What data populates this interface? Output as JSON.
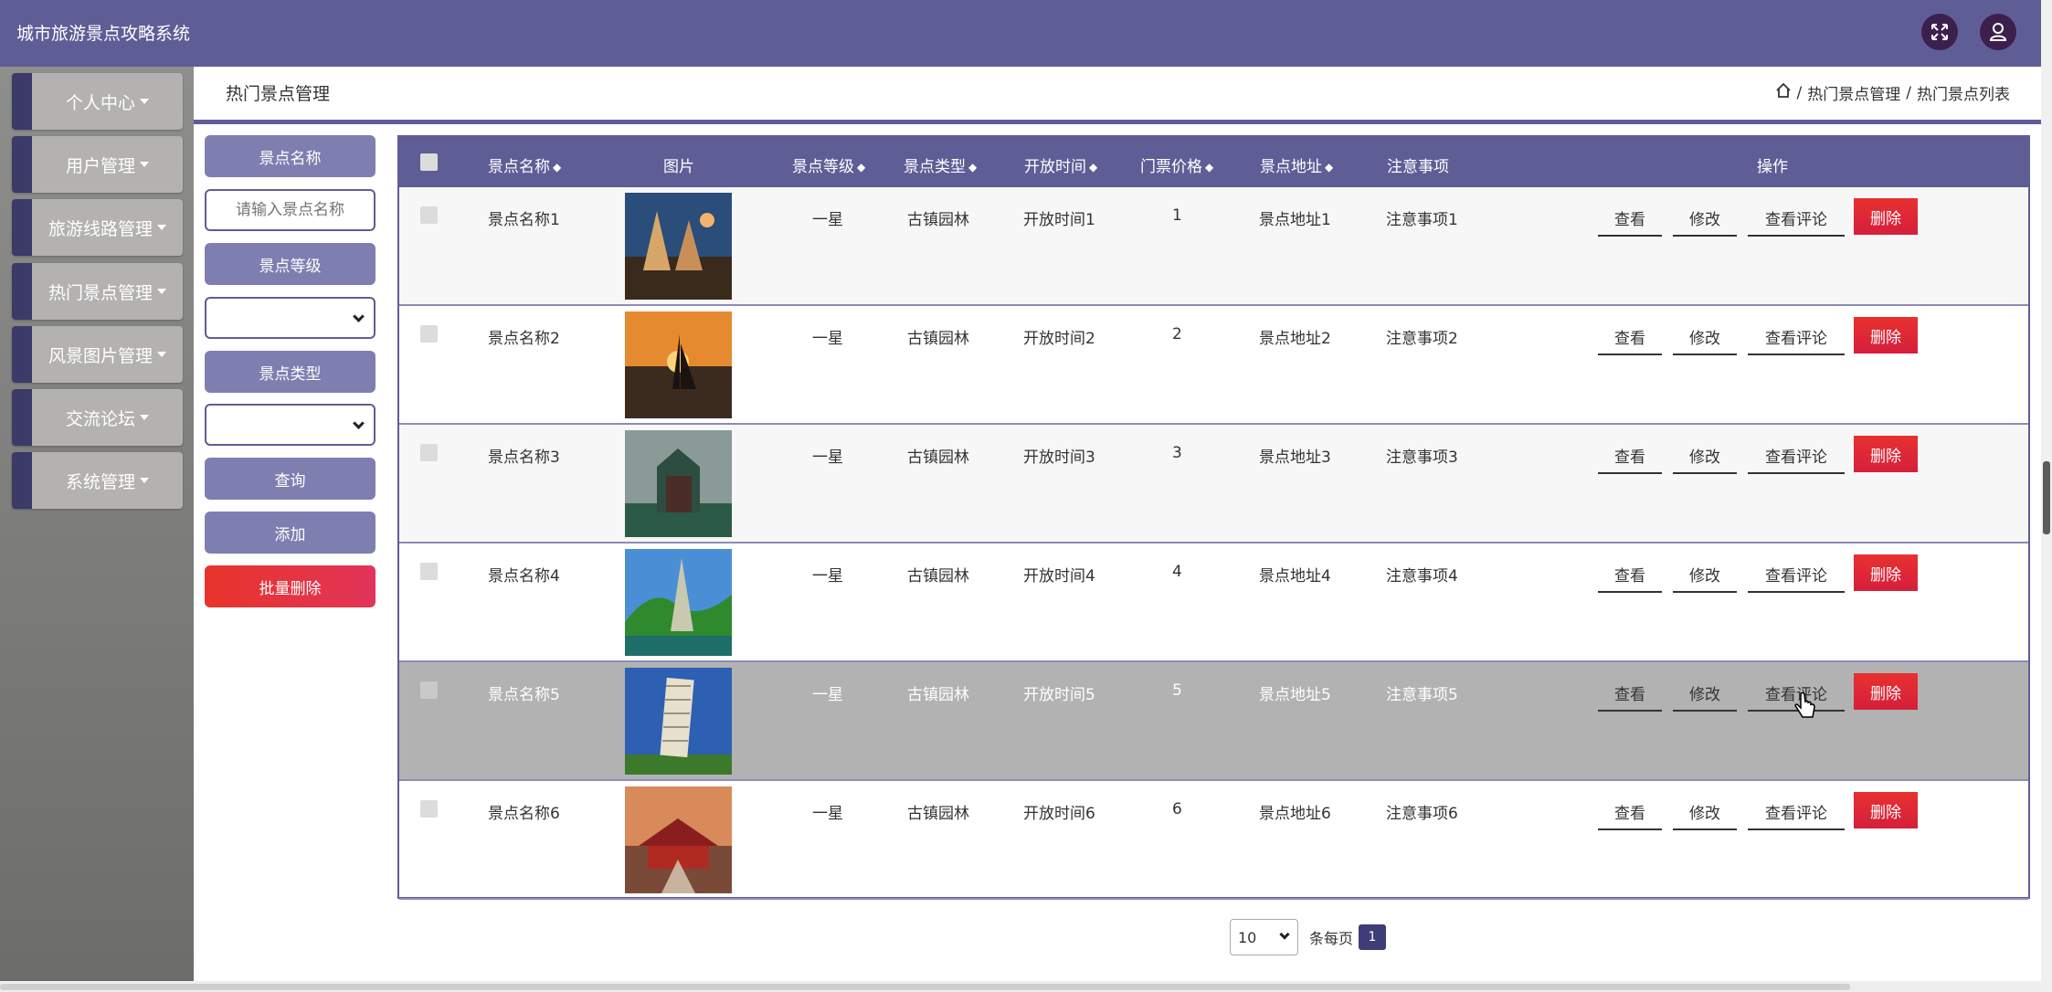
{
  "app": {
    "title": "城市旅游景点攻略系统"
  },
  "topbar_icons": [
    "fullscreen-icon",
    "user-icon"
  ],
  "sidebar": {
    "items": [
      {
        "label": "个人中心"
      },
      {
        "label": "用户管理"
      },
      {
        "label": "旅游线路管理"
      },
      {
        "label": "热门景点管理"
      },
      {
        "label": "风景图片管理"
      },
      {
        "label": "交流论坛"
      },
      {
        "label": "系统管理"
      }
    ]
  },
  "header": {
    "title": "热门景点管理",
    "breadcrumb": {
      "section": "热门景点管理",
      "current": "热门景点列表",
      "separator": "/"
    }
  },
  "filters": {
    "name_label": "景点名称",
    "name_placeholder": "请输入景点名称",
    "level_label": "景点等级",
    "level_value": "",
    "type_label": "景点类型",
    "type_value": "",
    "query_label": "查询",
    "add_label": "添加",
    "batch_delete_label": "批量删除"
  },
  "table": {
    "columns": [
      "景点名称",
      "图片",
      "景点等级",
      "景点类型",
      "开放时间",
      "门票价格",
      "景点地址",
      "注意事项",
      "操作"
    ],
    "actions": {
      "view": "查看",
      "edit": "修改",
      "comments": "查看评论",
      "delete": "删除"
    },
    "rows": [
      {
        "name": "景点名称1",
        "level": "一星",
        "type": "古镇园林",
        "open": "开放时间1",
        "price": "1",
        "address": "景点地址1",
        "notes": "注意事项1"
      },
      {
        "name": "景点名称2",
        "level": "一星",
        "type": "古镇园林",
        "open": "开放时间2",
        "price": "2",
        "address": "景点地址2",
        "notes": "注意事项2"
      },
      {
        "name": "景点名称3",
        "level": "一星",
        "type": "古镇园林",
        "open": "开放时间3",
        "price": "3",
        "address": "景点地址3",
        "notes": "注意事项3"
      },
      {
        "name": "景点名称4",
        "level": "一星",
        "type": "古镇园林",
        "open": "开放时间4",
        "price": "4",
        "address": "景点地址4",
        "notes": "注意事项4"
      },
      {
        "name": "景点名称5",
        "level": "一星",
        "type": "古镇园林",
        "open": "开放时间5",
        "price": "5",
        "address": "景点地址5",
        "notes": "注意事项5"
      },
      {
        "name": "景点名称6",
        "level": "一星",
        "type": "古镇园林",
        "open": "开放时间6",
        "price": "6",
        "address": "景点地址6",
        "notes": "注意事项6"
      }
    ]
  },
  "pagination": {
    "page_size": "10",
    "per_page_label": "条每页",
    "current_page": "1"
  },
  "colors": {
    "primary": "#5f5d96",
    "delete": "#e2233a",
    "sidebar_bg": "#7d7d7b"
  }
}
